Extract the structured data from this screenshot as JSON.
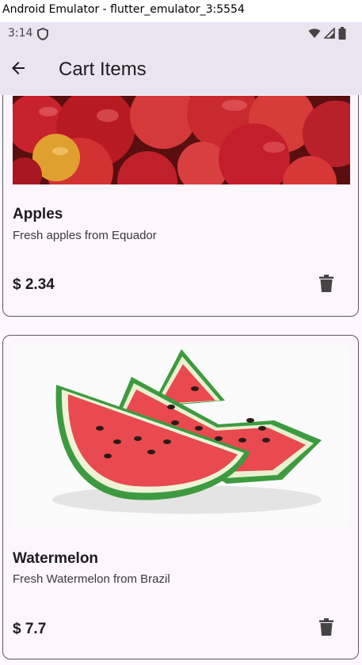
{
  "window": {
    "title": "Android Emulator - flutter_emulator_3:5554"
  },
  "status_bar": {
    "time": "3:14",
    "icons": [
      "shield-icon",
      "wifi-icon",
      "signal-icon",
      "battery-icon"
    ]
  },
  "app_bar": {
    "title": "Cart Items",
    "back_icon": "arrow-back-icon"
  },
  "cart": {
    "items": [
      {
        "name": "Apples",
        "description": "Fresh apples from Equador",
        "price": "$ 2.34",
        "image": "apples-photo",
        "action_icon": "trash-icon"
      },
      {
        "name": "Watermelon",
        "description": "Fresh Watermelon from Brazil",
        "price": "$ 7.7",
        "image": "watermelon-photo",
        "action_icon": "trash-icon"
      }
    ]
  },
  "colors": {
    "app_bar_bg": "#eae4f1",
    "page_bg": "#fef7ff",
    "card_bg": "#fdf6fd",
    "text_primary": "#1d1b20",
    "icon": "#444444"
  }
}
